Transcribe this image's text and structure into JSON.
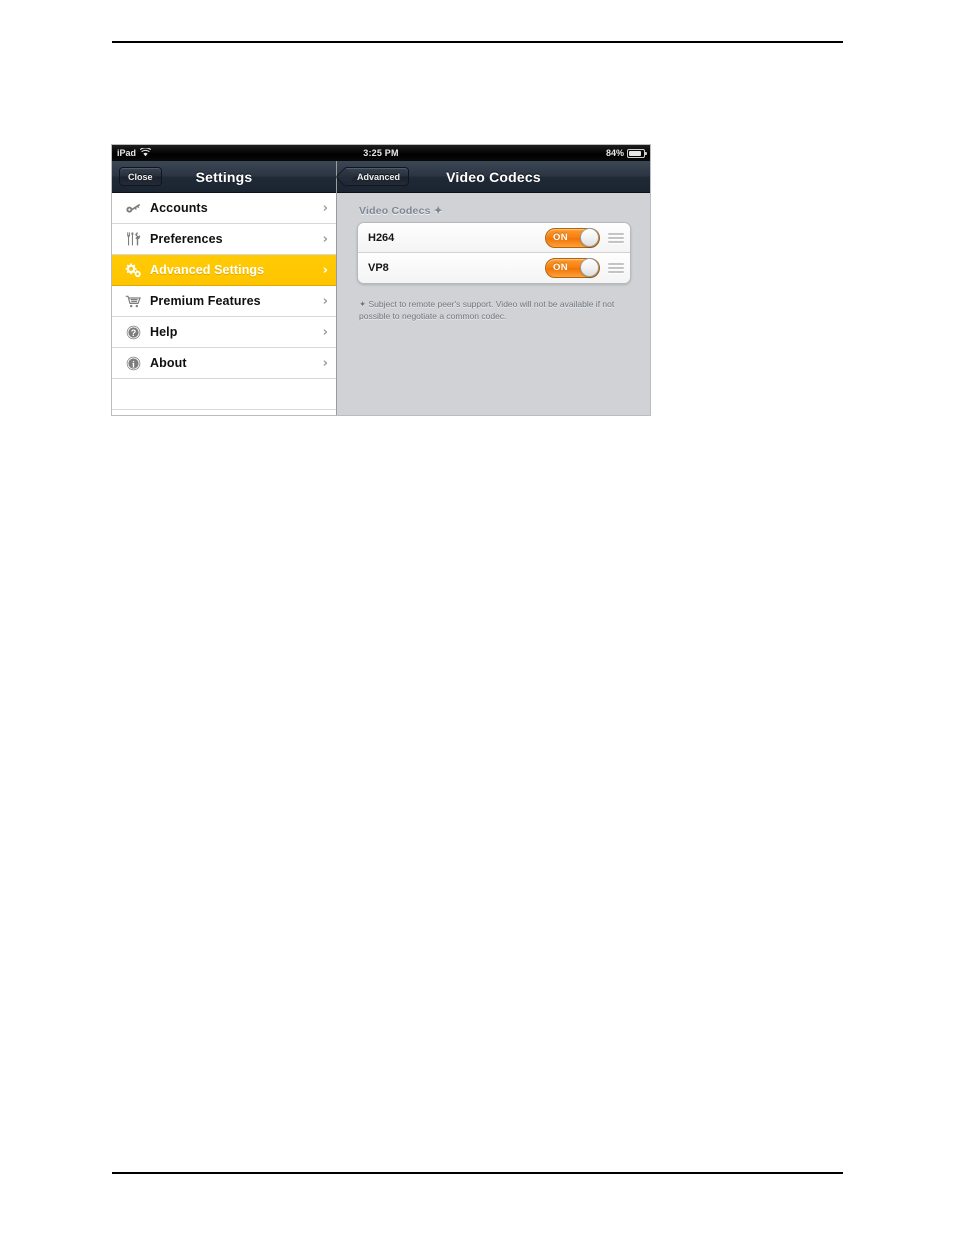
{
  "device": {
    "status_bar": {
      "carrier": "iPad",
      "wifi_icon": "wifi-icon",
      "time": "3:25 PM",
      "battery_percent": "84%",
      "battery_icon": "battery-icon"
    },
    "left_pane": {
      "navbar": {
        "close_label": "Close",
        "title": "Settings"
      },
      "items": [
        {
          "label": "Accounts",
          "icon": "key-icon",
          "chevron": "›",
          "selected": false
        },
        {
          "label": "Preferences",
          "icon": "tools-icon",
          "chevron": "›",
          "selected": false
        },
        {
          "label": "Advanced Settings",
          "icon": "gears-icon",
          "chevron": "›",
          "selected": true
        },
        {
          "label": "Premium Features",
          "icon": "cart-icon",
          "chevron": "›",
          "selected": false
        },
        {
          "label": "Help",
          "icon": "question-icon",
          "chevron": "›",
          "selected": false
        },
        {
          "label": "About",
          "icon": "info-icon",
          "chevron": "›",
          "selected": false
        }
      ]
    },
    "right_pane": {
      "navbar": {
        "back_label": "Advanced",
        "title": "Video Codecs"
      },
      "section_title": "Video Codecs ✦",
      "codecs": [
        {
          "name": "H264",
          "toggle_label": "ON",
          "enabled": true,
          "reorder_icon": "reorder-handle-icon"
        },
        {
          "name": "VP8",
          "toggle_label": "ON",
          "enabled": true,
          "reorder_icon": "reorder-handle-icon"
        }
      ],
      "footnote": "✦ Subject to remote peer's support. Video will not be available if not possible to negotiate a common codec."
    }
  },
  "colors": {
    "navbar_dark": "#2b3543",
    "selected_yellow": "#ffc400",
    "toggle_orange": "#f57f10",
    "detail_background": "#d0d2d5"
  }
}
